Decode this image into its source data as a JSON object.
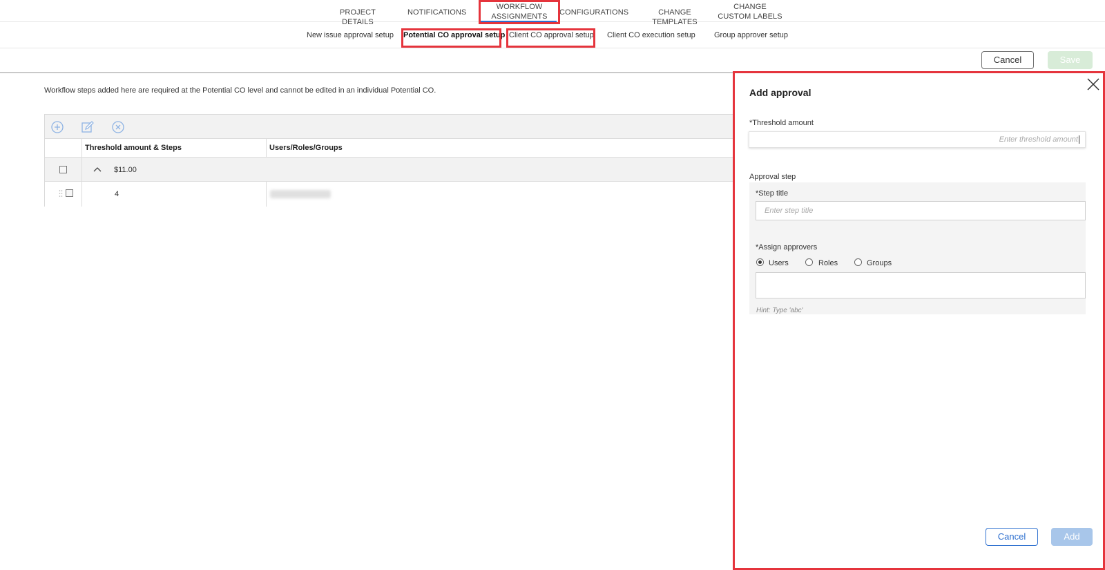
{
  "top_tabs": [
    "PROJECT DETAILS",
    "NOTIFICATIONS",
    "WORKFLOW ASSIGNMENTS",
    "CONFIGURATIONS",
    "CHANGE TEMPLATES",
    "CHANGE CUSTOM LABELS"
  ],
  "active_top_tab": "WORKFLOW ASSIGNMENTS",
  "sub_tabs": [
    "New issue approval setup",
    "Potential CO approval setup",
    "Client CO approval setup",
    "Client CO execution setup",
    "Group approver setup"
  ],
  "active_sub_tab": "Potential CO approval setup",
  "actions": {
    "cancel": "Cancel",
    "save": "Save"
  },
  "info_text": "Workflow steps added here are required at the Potential CO level and cannot be edited in an individual Potential CO.",
  "grid": {
    "toolbar_icons": [
      "add-icon",
      "edit-icon",
      "remove-icon"
    ],
    "columns": [
      "Threshold amount & Steps",
      "Users/Roles/Groups"
    ],
    "group_row": {
      "amount": "$11.00"
    },
    "step_row": {
      "step": "4"
    }
  },
  "panel": {
    "title": "Add approval",
    "threshold_label": "*Threshold amount",
    "threshold_placeholder": "Enter threshold amount",
    "approval_step_label": "Approval step",
    "step_title_label": "*Step title",
    "step_title_placeholder": "Enter step title",
    "assign_label": "*Assign approvers",
    "approver_options": [
      "Users",
      "Roles",
      "Groups"
    ],
    "selected_option": "Users",
    "hint": "Hint: Type 'abc'",
    "cancel": "Cancel",
    "add": "Add"
  },
  "colors": {
    "accent": "#2d6fcf",
    "highlight": "#e5343c",
    "save_disabled": "#d8ecd8",
    "add_disabled": "#a8c6ea"
  }
}
